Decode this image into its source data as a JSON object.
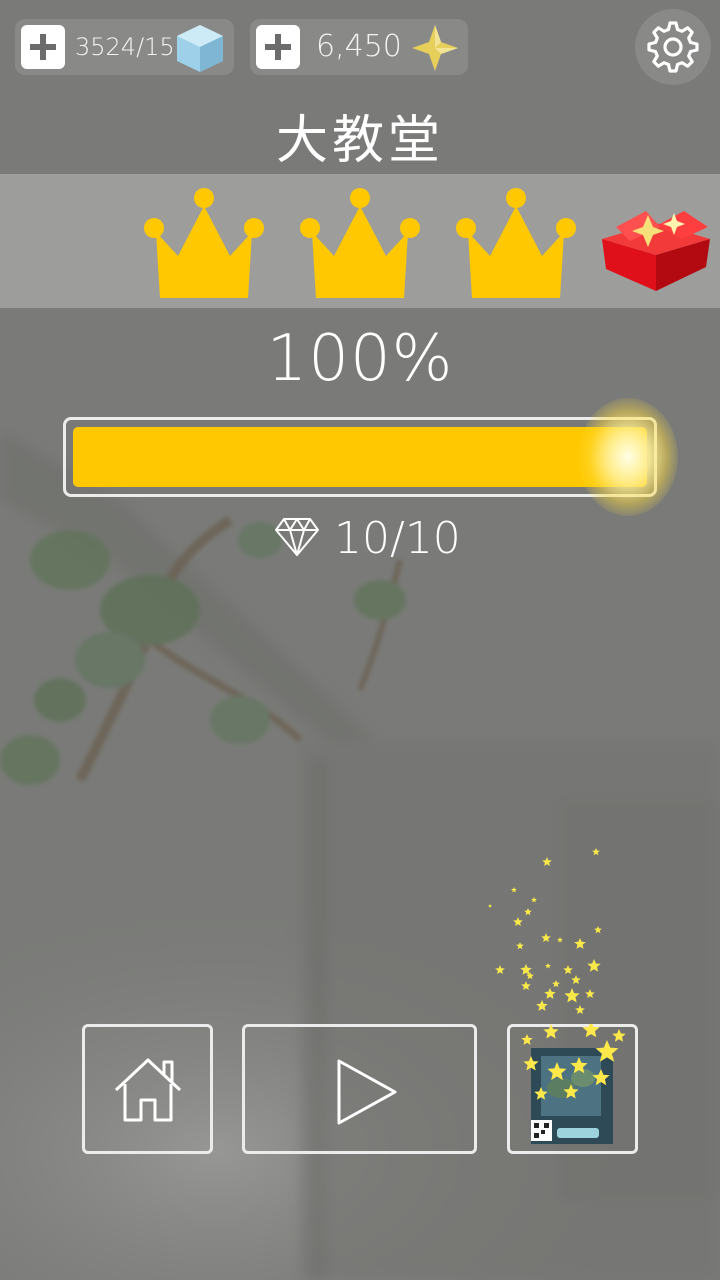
{
  "resources": {
    "cubes": "3524/15",
    "stars": "6,450"
  },
  "level": {
    "title": "大教堂",
    "crowns_earned": 3,
    "crowns_total": 3
  },
  "progress": {
    "percent_label": "100%",
    "fraction": 1.0
  },
  "gems": {
    "label": "10/10"
  },
  "icons": {
    "add": "plus-icon",
    "cube": "cube-icon",
    "star": "star-icon",
    "settings": "gear-icon",
    "crown": "crown-icon",
    "gift": "gift-box-icon",
    "diamond": "diamond-icon",
    "home": "home-icon",
    "play": "play-icon"
  },
  "colors": {
    "crown": "#ffc800",
    "bar_fill": "#ffc800",
    "gift": "#e8101c",
    "background": "#7b7c79"
  }
}
